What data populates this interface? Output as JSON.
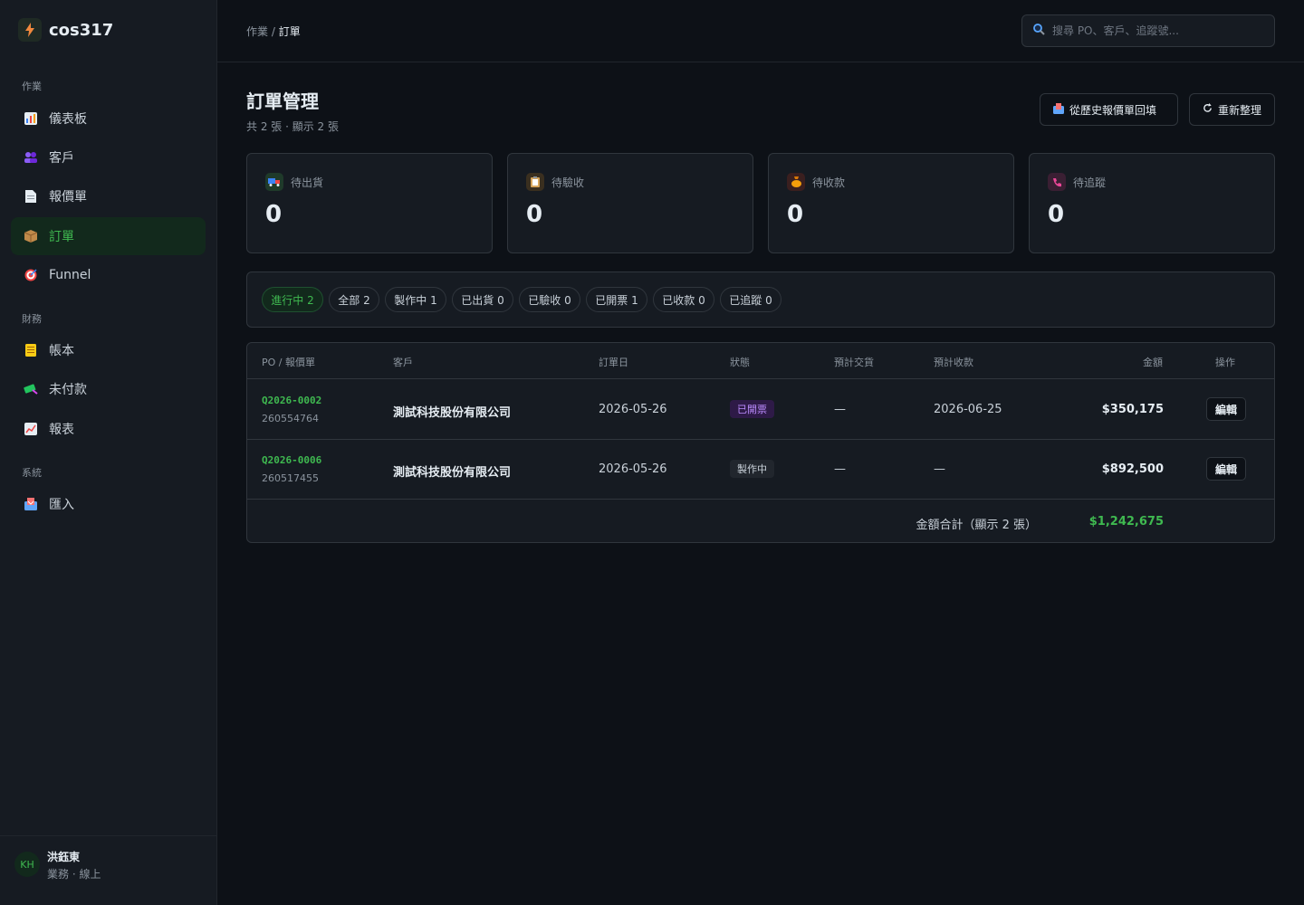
{
  "brand": {
    "name": "cos317",
    "icon": "lightning-icon"
  },
  "sidebar": {
    "sections": [
      {
        "label": "作業"
      },
      {
        "label": "財務"
      },
      {
        "label": "系統"
      }
    ],
    "items": [
      {
        "label": "儀表板",
        "icon": "chart-icon"
      },
      {
        "label": "客戶",
        "icon": "users-icon"
      },
      {
        "label": "報價單",
        "icon": "document-icon"
      },
      {
        "label": "訂單",
        "icon": "package-icon",
        "active": true
      },
      {
        "label": "Funnel",
        "icon": "target-icon"
      },
      {
        "label": "帳本",
        "icon": "ledger-icon"
      },
      {
        "label": "未付款",
        "icon": "money-icon"
      },
      {
        "label": "報表",
        "icon": "trend-icon"
      },
      {
        "label": "匯入",
        "icon": "inbox-icon"
      }
    ]
  },
  "user": {
    "initials": "KH",
    "name": "洪鈺東",
    "role": "業務 · 線上"
  },
  "header": {
    "breadcrumb_parent": "作業",
    "breadcrumb_sep": " / ",
    "breadcrumb_current": "訂單",
    "search_placeholder": "搜尋 PO、客戶、追蹤號..."
  },
  "page": {
    "title": "訂單管理",
    "subtitle": "共 2 張 · 顯示 2 張",
    "history_button": "從歷史報價單回填",
    "refresh_button": "重新整理"
  },
  "stats": [
    {
      "label": "待出貨",
      "value": "0",
      "icon": "truck-icon",
      "color": "#1f3a2a"
    },
    {
      "label": "待驗收",
      "value": "0",
      "icon": "clipboard-icon",
      "color": "#3a2f1f"
    },
    {
      "label": "待收款",
      "value": "0",
      "icon": "money-bag-icon",
      "color": "#3a1f1f"
    },
    {
      "label": "待追蹤",
      "value": "0",
      "icon": "phone-icon",
      "color": "#3a1f33"
    }
  ],
  "filters": [
    {
      "label": "進行中 2",
      "active": true
    },
    {
      "label": "全部 2"
    },
    {
      "label": "製作中 1"
    },
    {
      "label": "已出貨 0"
    },
    {
      "label": "已驗收 0"
    },
    {
      "label": "已開票 1"
    },
    {
      "label": "已收款 0"
    },
    {
      "label": "已追蹤 0"
    }
  ],
  "table": {
    "columns": [
      "PO / 報價單",
      "客戶",
      "訂單日",
      "狀態",
      "預計交貨",
      "預計收款",
      "金額",
      "操作"
    ],
    "rows": [
      {
        "po": "Q2026-0002",
        "quote": "260554764",
        "customer": "測試科技股份有限公司",
        "order_date": "2026-05-26",
        "status": "已開票",
        "delivery": "—",
        "payment": "2026-06-25",
        "amount": "$350,175",
        "action": "編輯"
      },
      {
        "po": "Q2026-0006",
        "quote": "260517455",
        "customer": "測試科技股份有限公司",
        "order_date": "2026-05-26",
        "status": "製作中",
        "delivery": "—",
        "payment": "—",
        "amount": "$892,500",
        "action": "編輯"
      }
    ],
    "total_label": "金額合計（顯示 2 張）",
    "total_value": "$1,242,675"
  },
  "colors": {
    "accent": "#3fb950",
    "background": "#0d1117",
    "panel": "#161b22",
    "invoiced": "#bc8cff"
  }
}
